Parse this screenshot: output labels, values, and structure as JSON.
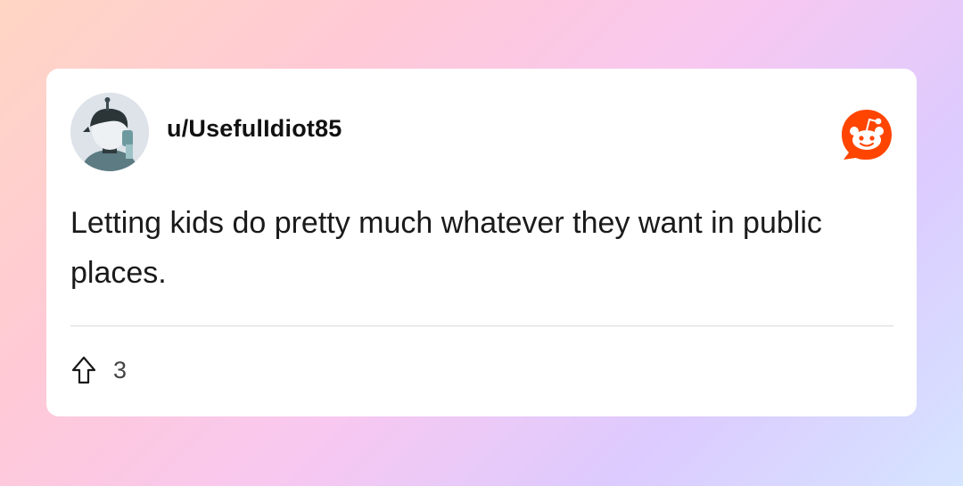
{
  "post": {
    "username": "u/UsefulIdiot85",
    "body": "Letting kids do pretty much whatever they want in public places.",
    "upvotes": "3"
  },
  "icons": {
    "avatar": "user-avatar",
    "brand": "reddit-logo-icon",
    "vote": "upvote-arrow-icon"
  },
  "colors": {
    "brand": "#ff4500",
    "text": "#1a1a1a",
    "muted": "#444444"
  }
}
